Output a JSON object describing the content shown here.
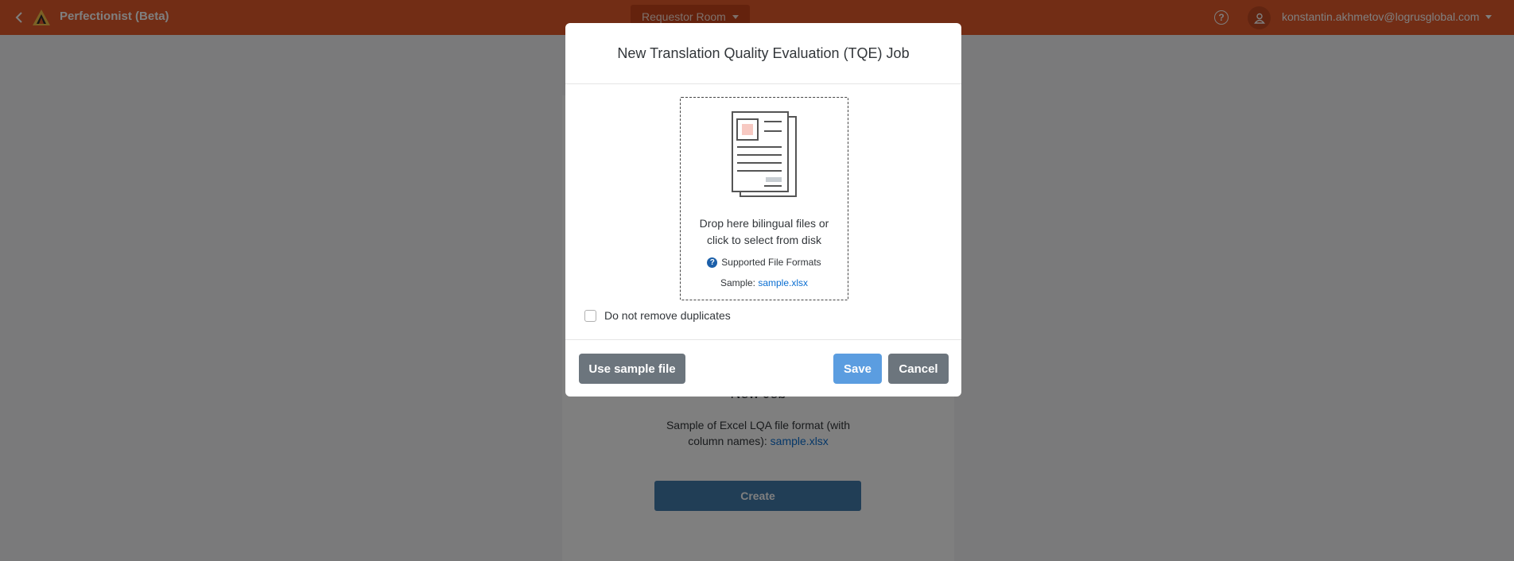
{
  "header": {
    "app_title": "Perfectionist (Beta)",
    "room_label": "Requestor Room",
    "user_email": "konstantin.akhmetov@logrusglobal.com"
  },
  "background": {
    "heading": "New Job",
    "sample_text_1": "Sample of Excel LQA file format (with",
    "sample_text_2": "column names): ",
    "sample_link": "sample.xlsx",
    "create_label": "Create"
  },
  "modal": {
    "title": "New Translation Quality Evaluation (TQE) Job",
    "drop_text_1": "Drop here bilingual files or",
    "drop_text_2": "click to select from disk",
    "formats_label": "Supported File Formats",
    "sample_prefix": "Sample: ",
    "sample_link": "sample.xlsx",
    "checkbox_label": "Do not remove duplicates",
    "checkbox_checked": false,
    "use_sample_label": "Use sample file",
    "save_label": "Save",
    "cancel_label": "Cancel"
  },
  "colors": {
    "header": "#e55a2b",
    "link": "#0a6ed1",
    "save": "#5b9de0",
    "secondary": "#6c757d"
  },
  "icons": [
    "back-icon",
    "app-logo-icon",
    "help-icon",
    "user-icon",
    "document-icon",
    "question-icon"
  ]
}
